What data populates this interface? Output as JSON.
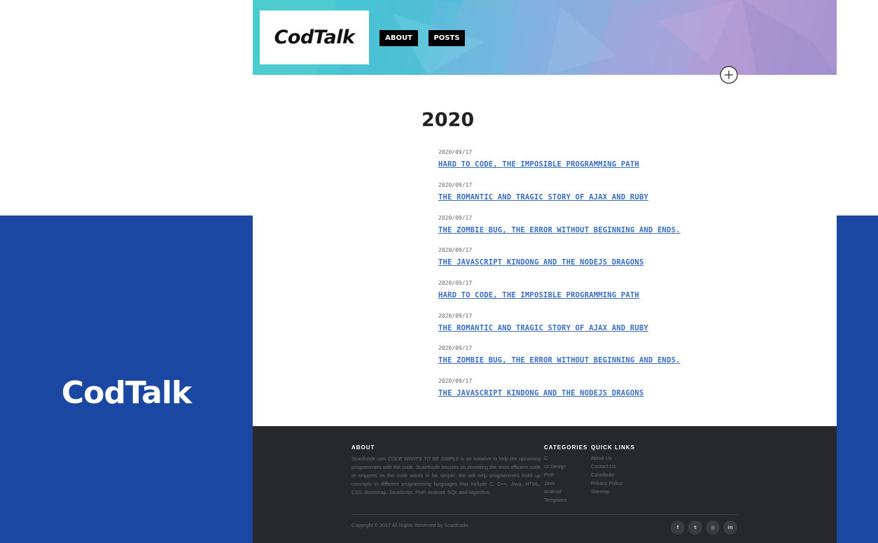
{
  "brand": {
    "name": "CodTalk",
    "side_name": "CodTalk"
  },
  "nav": {
    "about": "ABOUT",
    "posts": "POSTS"
  },
  "archive": {
    "year": "2020",
    "posts": [
      {
        "date": "2020/09/17",
        "title": "HARD TO CODE, THE IMPOSIBLE PROGRAMMING PATH"
      },
      {
        "date": "2020/09/17",
        "title": "THE ROMANTIC AND TRAGIC STORY OF AJAX AND RUBY"
      },
      {
        "date": "2020/09/17",
        "title": "THE ZOMBIE BUG, THE ERROR WITHOUT BEGINNING AND ENDS."
      },
      {
        "date": "2020/09/17",
        "title": "THE JAVASCRIPT KINDONG AND THE NODEJS DRAGONS"
      },
      {
        "date": "2020/09/17",
        "title": "HARD TO CODE, THE IMPOSIBLE PROGRAMMING PATH"
      },
      {
        "date": "2020/09/17",
        "title": "THE ROMANTIC AND TRAGIC STORY OF AJAX AND RUBY"
      },
      {
        "date": "2020/09/17",
        "title": "THE ZOMBIE BUG, THE ERROR WITHOUT BEGINNING AND ENDS."
      },
      {
        "date": "2020/09/17",
        "title": "THE JAVASCRIPT KINDONG AND THE NODEJS DRAGONS"
      }
    ]
  },
  "footer": {
    "about_heading": "ABOUT",
    "about_prefix": "Scanfcode.com ",
    "about_em": "CODE WANTS TO BE SIMPLE",
    "about_rest": " is an initiative to help the upcoming programmers with the code. Scanfcode focuses on providing the most efficient code or snippets as the code wants to be simple. We will help programmers build up concepts in different programming languages that include C, C++, Java, HTML, CSS, Bootstrap, JavaScript, PHP, Android, SQL and Algorithm.",
    "categories_heading": "CATEGORIES",
    "categories": [
      "C",
      "UI Design",
      "PHP",
      "Java",
      "Android",
      "Templates"
    ],
    "quicklinks_heading": "QUICK LINKS",
    "quicklinks": [
      "About Us",
      "Contact Us",
      "Contribute",
      "Privacy Policy",
      "Sitemap"
    ],
    "copyright": "Copyright © 2017 All Rights Reserved by Scanfcode.",
    "social": {
      "facebook": "f",
      "twitter": "t",
      "dribbble": "◎",
      "linkedin": "in"
    }
  },
  "colors": {
    "brand_blue": "#1a47a1",
    "link_blue": "#3b6fc4",
    "footer_bg": "#27282b"
  },
  "icons": [
    "plus-circle-icon",
    "facebook-icon",
    "twitter-icon",
    "dribbble-icon",
    "linkedin-icon"
  ]
}
